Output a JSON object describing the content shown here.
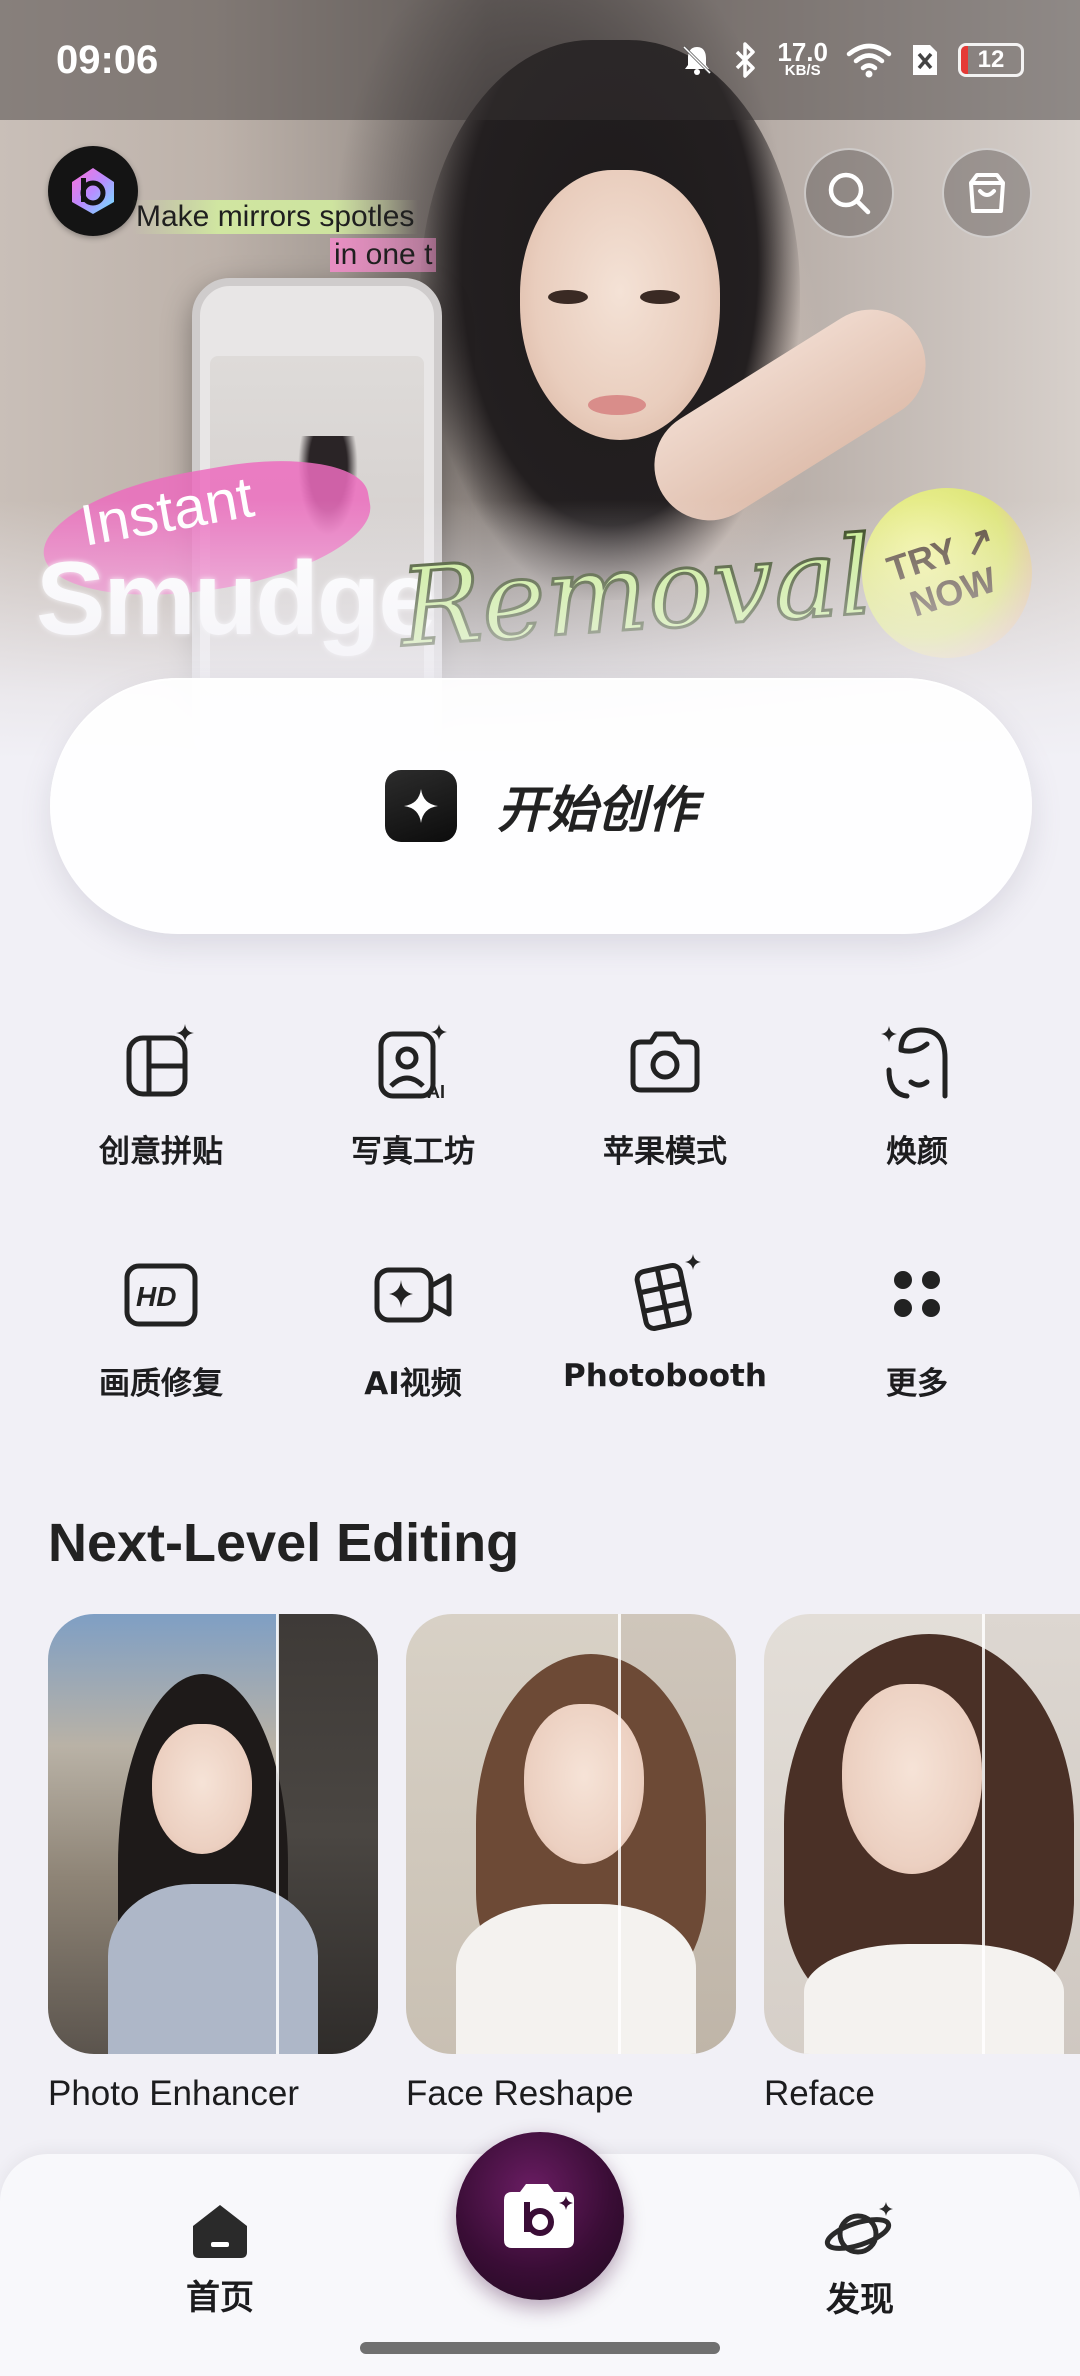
{
  "status_bar": {
    "time": "09:06",
    "net_speed": "17.0",
    "net_unit": "KB/S",
    "battery": "12",
    "battery_level": 0.12,
    "icons": [
      "mute-bell-icon",
      "bluetooth-icon",
      "wifi-icon",
      "sim-x-icon",
      "battery-icon"
    ]
  },
  "hero": {
    "tagline_line1": "Make mirrors spotles",
    "tagline_line2": "in one t",
    "headline_small": "Instant",
    "headline_big": "Smudge",
    "headline_script": "Removal",
    "badge_line1": "TRY ↗",
    "badge_line2": "NOW",
    "actions": [
      "search-icon",
      "shop-bag-icon"
    ]
  },
  "create": {
    "label": "开始创作",
    "icon": "sparkle-icon"
  },
  "tools": [
    {
      "label": "创意拼贴",
      "icon": "collage-icon"
    },
    {
      "label": "写真工坊",
      "icon": "ai-portrait-icon"
    },
    {
      "label": "苹果模式",
      "icon": "camera-icon"
    },
    {
      "label": "焕颜",
      "icon": "face-glow-icon"
    },
    {
      "label": "画质修复",
      "icon": "hd-icon"
    },
    {
      "label": "AI视频",
      "icon": "ai-video-icon"
    },
    {
      "label": "Photobooth",
      "icon": "photobooth-icon"
    },
    {
      "label": "更多",
      "icon": "more-dots-icon"
    }
  ],
  "section": {
    "title": "Next-Level Editing"
  },
  "cards": [
    {
      "label": "Photo Enhancer"
    },
    {
      "label": "Face Reshape"
    },
    {
      "label": "Reface"
    }
  ],
  "nav": {
    "home": "首页",
    "discover": "发现",
    "active": "home"
  },
  "colors": {
    "background": "#f1f0f6",
    "fab": "#3a0d36",
    "accent_green": "#c8ef8f",
    "accent_pink": "#ec6cbe"
  }
}
